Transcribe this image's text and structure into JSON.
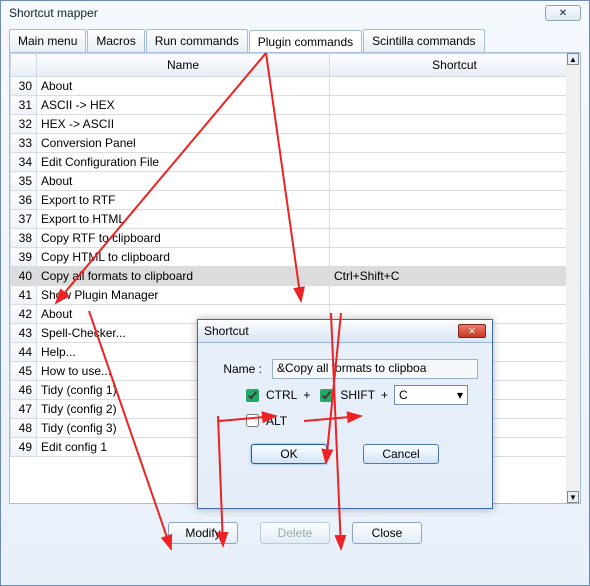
{
  "window": {
    "title": "Shortcut mapper"
  },
  "tabs": [
    {
      "label": "Main menu"
    },
    {
      "label": "Macros"
    },
    {
      "label": "Run commands"
    },
    {
      "label": "Plugin commands",
      "active": true
    },
    {
      "label": "Scintilla commands"
    }
  ],
  "columns": {
    "name": "Name",
    "shortcut": "Shortcut"
  },
  "rows": [
    {
      "n": 30,
      "name": "About",
      "shortcut": ""
    },
    {
      "n": 31,
      "name": "ASCII -> HEX",
      "shortcut": ""
    },
    {
      "n": 32,
      "name": "HEX -> ASCII",
      "shortcut": ""
    },
    {
      "n": 33,
      "name": "Conversion Panel",
      "shortcut": ""
    },
    {
      "n": 34,
      "name": "Edit Configuration File",
      "shortcut": ""
    },
    {
      "n": 35,
      "name": "About",
      "shortcut": ""
    },
    {
      "n": 36,
      "name": "Export to RTF",
      "shortcut": ""
    },
    {
      "n": 37,
      "name": "Export to HTML",
      "shortcut": ""
    },
    {
      "n": 38,
      "name": "Copy RTF to clipboard",
      "shortcut": ""
    },
    {
      "n": 39,
      "name": "Copy HTML to clipboard",
      "shortcut": ""
    },
    {
      "n": 40,
      "name": "Copy all formats to clipboard",
      "shortcut": "Ctrl+Shift+C",
      "selected": true
    },
    {
      "n": 41,
      "name": "Show Plugin Manager",
      "shortcut": ""
    },
    {
      "n": 42,
      "name": "About",
      "shortcut": ""
    },
    {
      "n": 43,
      "name": "Spell-Checker...",
      "shortcut": ""
    },
    {
      "n": 44,
      "name": "Help...",
      "shortcut": ""
    },
    {
      "n": 45,
      "name": "How to use...",
      "shortcut": ""
    },
    {
      "n": 46,
      "name": "Tidy (config 1)",
      "shortcut": ""
    },
    {
      "n": 47,
      "name": "Tidy (config 2)",
      "shortcut": ""
    },
    {
      "n": 48,
      "name": "Tidy (config 3)",
      "shortcut": ""
    },
    {
      "n": 49,
      "name": "Edit config 1",
      "shortcut": ""
    }
  ],
  "buttons": {
    "modify": "Modify",
    "delete": "Delete",
    "close": "Close"
  },
  "dialog": {
    "title": "Shortcut",
    "name_label": "Name :",
    "name_value": "&Copy all formats to clipboa",
    "ctrl_label": "CTRL",
    "shift_label": "SHIFT",
    "alt_label": "ALT",
    "ctrl_checked": true,
    "shift_checked": true,
    "alt_checked": false,
    "key": "C",
    "ok": "OK",
    "cancel": "Cancel"
  }
}
